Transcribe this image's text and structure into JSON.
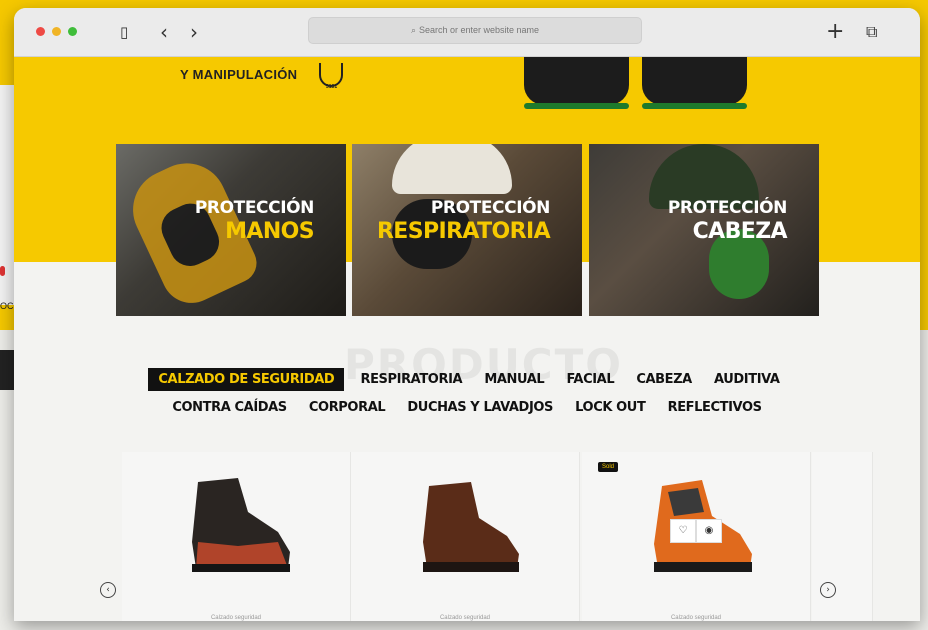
{
  "browser": {
    "url_placeholder": "Search or enter website name",
    "back_glyph": "‹",
    "forward_glyph": "›",
    "new_tab_glyph": "+",
    "tabs_glyph": "⧉",
    "sidebar_glyph": "▯"
  },
  "hero": {
    "text": "Y MANIPULACIÓN",
    "logo_small": "3131"
  },
  "categories": [
    {
      "line1": "PROTECCIÓN",
      "line2": "MANOS"
    },
    {
      "line1": "PROTECCIÓN",
      "line2": "RESPIRATORIA"
    },
    {
      "line1": "PROTECCIÓN",
      "line2": "CABEZA"
    }
  ],
  "section_watermark": "PRODUCTO",
  "product_tabs_row1": [
    {
      "label": "CALZADO DE SEGURIDAD",
      "active": true
    },
    {
      "label": "RESPIRATORIA"
    },
    {
      "label": "MANUAL"
    },
    {
      "label": "FACIAL"
    },
    {
      "label": "CABEZA"
    },
    {
      "label": "AUDITIVA"
    }
  ],
  "product_tabs_row2": [
    {
      "label": "CONTRA CAÍDAS"
    },
    {
      "label": "CORPORAL"
    },
    {
      "label": "DUCHAS Y LAVADJOS"
    },
    {
      "label": "LOCK OUT"
    },
    {
      "label": "REFLECTIVOS"
    }
  ],
  "products": [
    {
      "name": "Calzado seguridad"
    },
    {
      "name": "Calzado seguridad"
    },
    {
      "name": "Calzado seguridad",
      "badge": "Sold"
    }
  ],
  "carousel": {
    "prev_glyph": "‹",
    "next_glyph": "›"
  },
  "side_fragment_text": "OC",
  "colors": {
    "brand_yellow": "#f6c900",
    "dark": "#111111"
  }
}
